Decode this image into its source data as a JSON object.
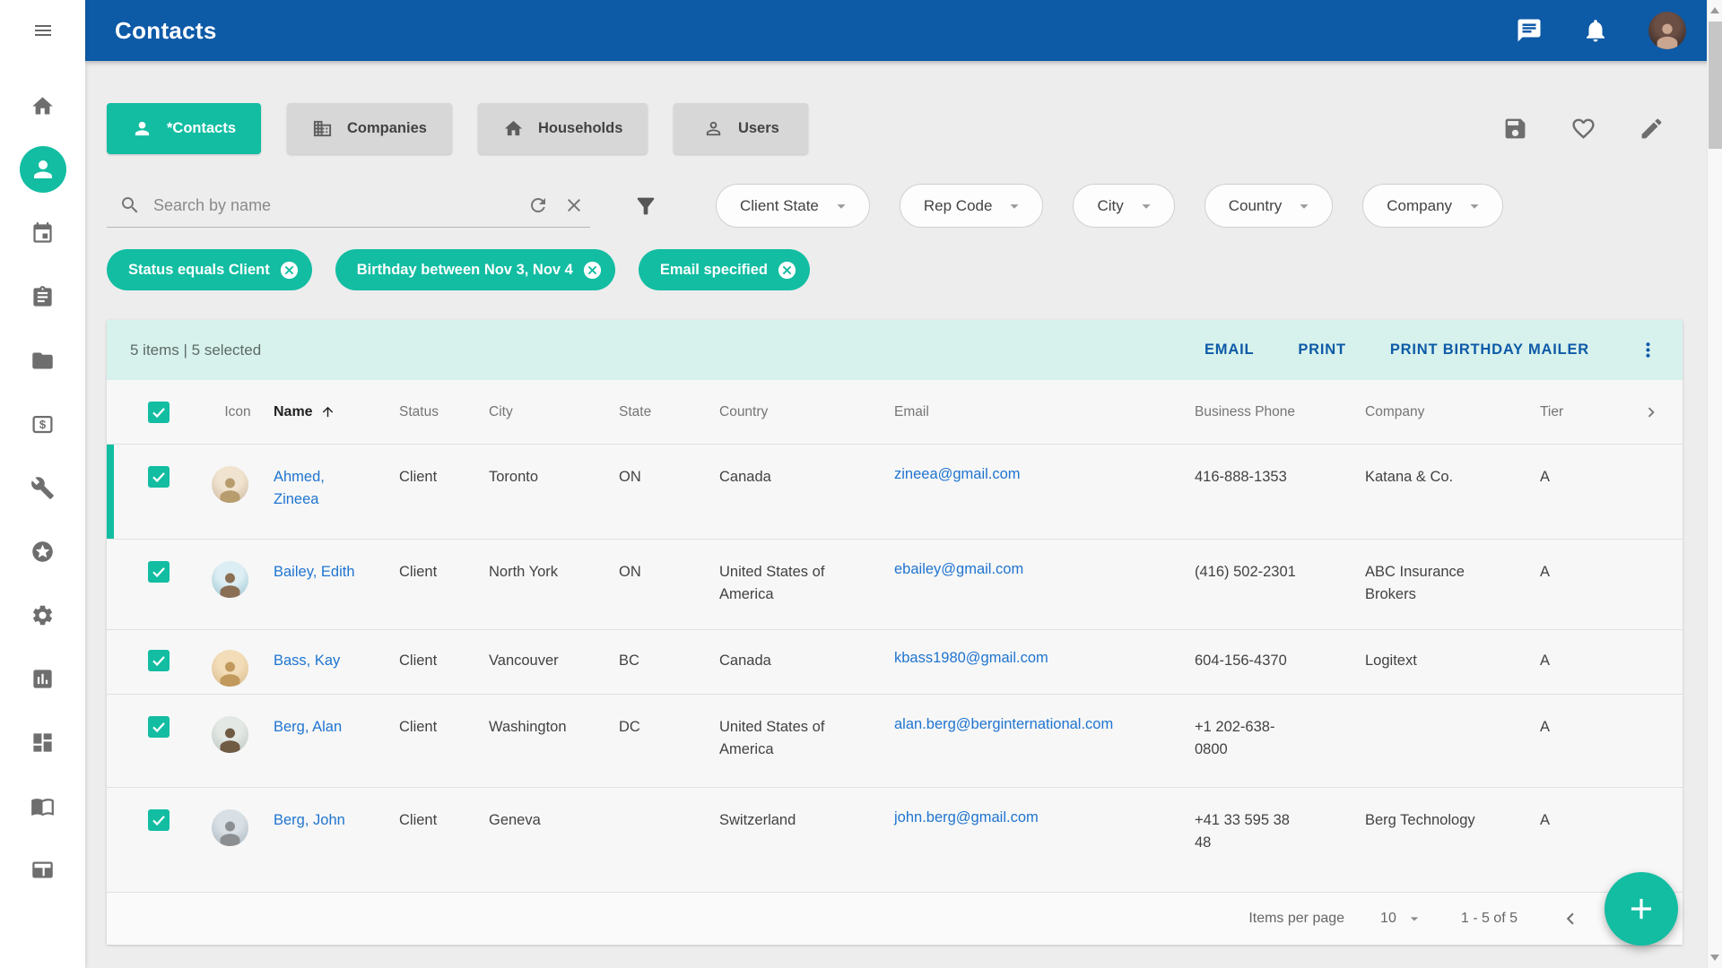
{
  "header": {
    "title": "Contacts"
  },
  "tabs": [
    {
      "label": "*Contacts",
      "icon": "person-icon",
      "active": true
    },
    {
      "label": "Companies",
      "icon": "building-icon",
      "active": false
    },
    {
      "label": "Households",
      "icon": "home-icon",
      "active": false
    },
    {
      "label": "Users",
      "icon": "person-outline-icon",
      "active": false
    }
  ],
  "search": {
    "placeholder": "Search by name"
  },
  "filters": {
    "dropdowns": [
      {
        "label": "Client State"
      },
      {
        "label": "Rep Code"
      },
      {
        "label": "City"
      },
      {
        "label": "Country"
      },
      {
        "label": "Company"
      }
    ],
    "chips": [
      {
        "label": "Status equals Client"
      },
      {
        "label": "Birthday between Nov 3, Nov 4"
      },
      {
        "label": "Email specified"
      }
    ]
  },
  "grid": {
    "summary": "5 items | 5 selected",
    "actions": [
      {
        "label": "EMAIL"
      },
      {
        "label": "PRINT"
      },
      {
        "label": "PRINT BIRTHDAY MAILER"
      }
    ],
    "columns": {
      "icon": "Icon",
      "name": "Name",
      "status": "Status",
      "city": "City",
      "state": "State",
      "country": "Country",
      "email": "Email",
      "business_phone": "Business Phone",
      "company": "Company",
      "tier": "Tier"
    },
    "rows": [
      {
        "name": "Ahmed, Zineea",
        "status": "Client",
        "city": "Toronto",
        "state": "ON",
        "country": "Canada",
        "email": "zineea@gmail.com",
        "business_phone": "416-888-1353",
        "company": "Katana & Co.",
        "tier": "A",
        "selected": true
      },
      {
        "name": "Bailey, Edith",
        "status": "Client",
        "city": "North York",
        "state": "ON",
        "country": "United States of America",
        "email": "ebailey@gmail.com",
        "business_phone": "(416) 502-2301",
        "company": "ABC Insurance Brokers",
        "tier": "A",
        "selected": true
      },
      {
        "name": "Bass, Kay",
        "status": "Client",
        "city": "Vancouver",
        "state": "BC",
        "country": "Canada",
        "email": "kbass1980@gmail.com",
        "business_phone": "604-156-4370",
        "company": "Logitext",
        "tier": "A",
        "selected": true
      },
      {
        "name": "Berg, Alan",
        "status": "Client",
        "city": "Washington",
        "state": "DC",
        "country": "United States of America",
        "email": "alan.berg@berginternational.com",
        "business_phone": "+1 202-638-0800",
        "company": "",
        "tier": "A",
        "selected": true
      },
      {
        "name": "Berg, John",
        "status": "Client",
        "city": "Geneva",
        "state": "",
        "country": "Switzerland",
        "email": "john.berg@gmail.com",
        "business_phone": "+41 33 595 38 48",
        "company": "Berg Technology",
        "tier": "A",
        "selected": true
      }
    ]
  },
  "pagination": {
    "items_per_page_label": "Items per page",
    "page_size": "10",
    "range": "1 - 5 of 5"
  },
  "colors": {
    "accent_teal": "#12bda2",
    "header_blue": "#0d5aa7",
    "mint_bar": "#d7f2ec",
    "link_blue": "#1f74d0"
  }
}
